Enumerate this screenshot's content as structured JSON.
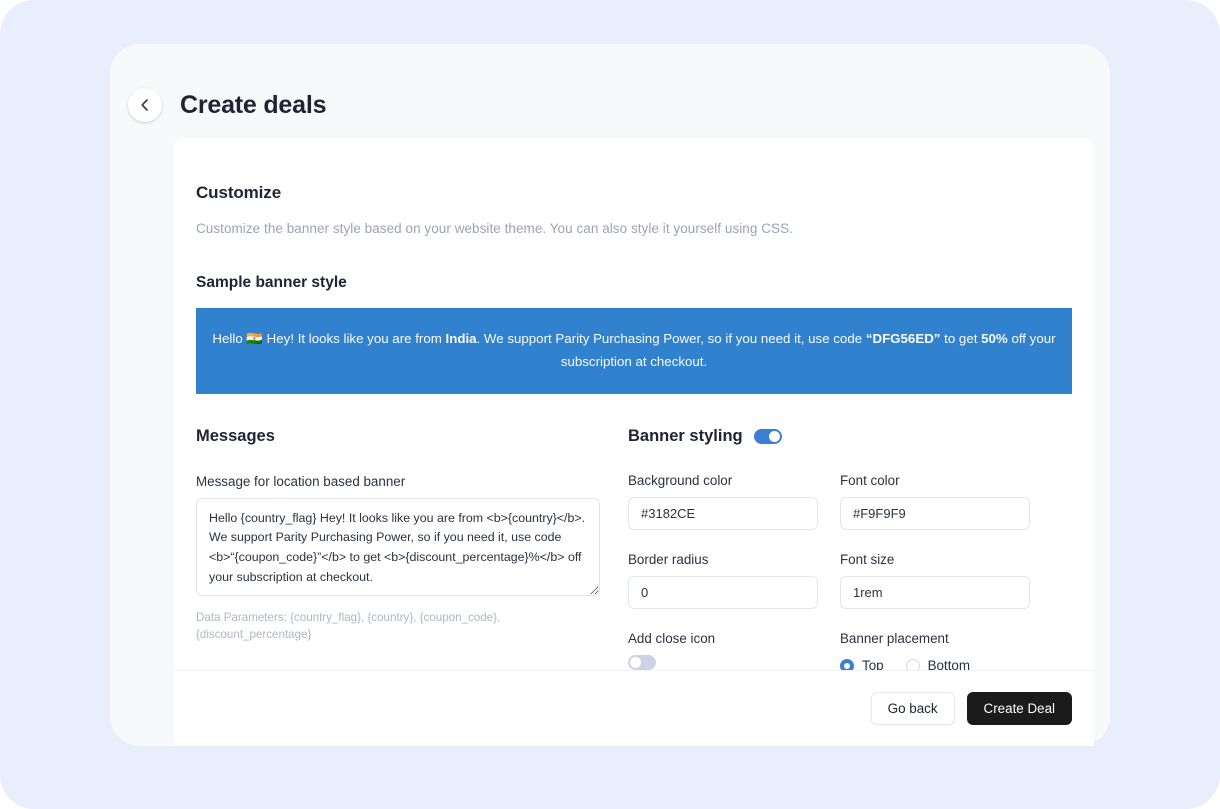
{
  "header": {
    "title": "Create deals",
    "back_icon": "chevron-left-icon"
  },
  "customize": {
    "title": "Customize",
    "description": "Customize the banner style based on your website theme. You can also style it yourself using CSS.",
    "sample_title": "Sample banner style"
  },
  "sample_banner": {
    "text_part_1": "Hello 🇮🇳 Hey! It looks like you are from ",
    "country": "India",
    "text_part_2": ". We support Parity Purchasing Power, so if you need it, use code ",
    "coupon_code": "“DFG56ED”",
    "text_part_3": " to get ",
    "discount": "50%",
    "text_part_4": " off your subscription at checkout.",
    "background_color": "#3182CE",
    "font_color": "#F9F9F9"
  },
  "messages": {
    "title": "Messages",
    "field_label": "Message for location based banner",
    "textarea_value": "Hello {country_flag} Hey! It looks like you are from <b>{country}</b>. We support Parity Purchasing Power, so if you need it, use code <b>“{coupon_code}”</b> to get <b>{discount_percentage}%</b> off your subscription at checkout.",
    "params_note": "Data Parameters: {country_flag}, {country}, {coupon_code}, {discount_percentage}"
  },
  "banner_styling": {
    "title": "Banner styling",
    "enabled": true,
    "fields": {
      "background_color_label": "Background color",
      "background_color_value": "#3182CE",
      "font_color_label": "Font color",
      "font_color_value": "#F9F9F9",
      "border_radius_label": "Border radius",
      "border_radius_value": "0",
      "font_size_label": "Font size",
      "font_size_value": "1rem"
    },
    "close_icon": {
      "label": "Add close icon",
      "enabled": false
    },
    "placement": {
      "label": "Banner placement",
      "options": [
        {
          "label": "Top",
          "selected": true
        },
        {
          "label": "Bottom",
          "selected": false
        }
      ]
    }
  },
  "footer": {
    "go_back_label": "Go back",
    "create_deal_label": "Create Deal"
  },
  "colors": {
    "accent": "#3b7fd4",
    "page_background": "#e9eefc",
    "window_background": "#f7f9fb",
    "card_background": "#ffffff",
    "primary_button": "#1b1b1b"
  }
}
